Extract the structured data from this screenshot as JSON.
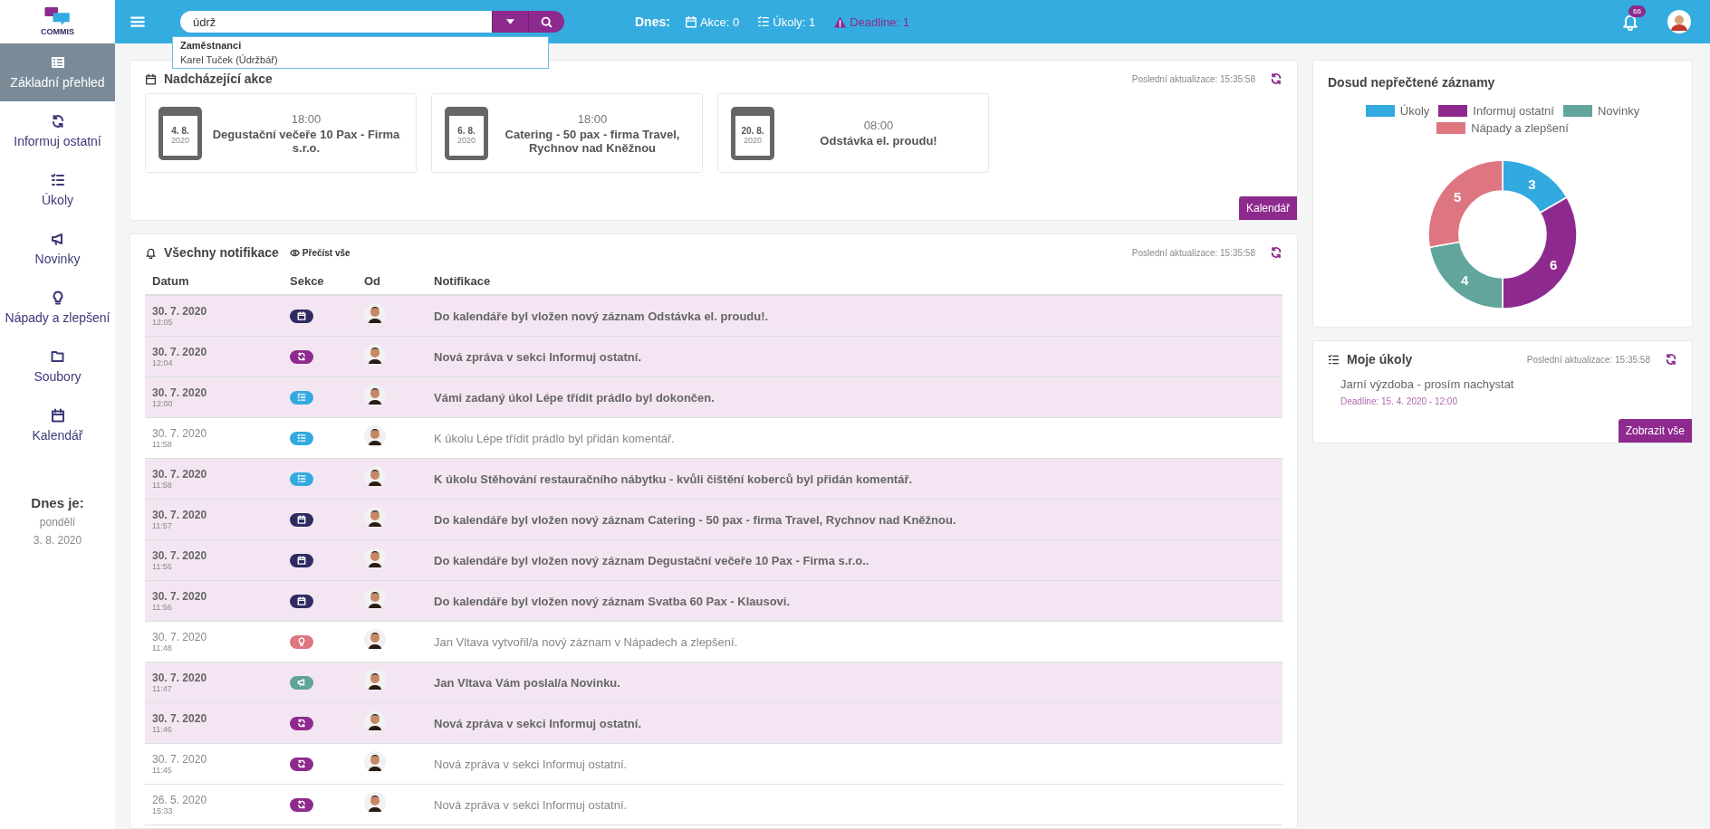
{
  "logo": {
    "text": "COMMIS"
  },
  "topbar": {
    "search": {
      "value": "údrž"
    },
    "today_label": "Dnes:",
    "stats": [
      {
        "kind": "calendar",
        "text": "Akce: 0"
      },
      {
        "kind": "checklist",
        "text": "Úkoly: 1"
      },
      {
        "kind": "warning",
        "text": "Deadline: 1"
      }
    ],
    "notification_count": "66"
  },
  "search_dropdown": {
    "heading": "Zaměstnanci",
    "items": [
      "Karel Tuček (Údržbář)"
    ]
  },
  "sidebar": {
    "items": [
      {
        "kind": "table",
        "label": "Základní přehled",
        "selected": true
      },
      {
        "kind": "refresh",
        "label": "Informuj ostatní",
        "selected": false
      },
      {
        "kind": "checklist",
        "label": "Úkoly",
        "selected": false
      },
      {
        "kind": "megaphone",
        "label": "Novinky",
        "selected": false
      },
      {
        "kind": "lightbulb",
        "label": "Nápady a zlepšení",
        "selected": false
      },
      {
        "kind": "folder",
        "label": "Soubory",
        "selected": false
      },
      {
        "kind": "calendar",
        "label": "Kalendář",
        "selected": false
      }
    ],
    "today_heading": "Dnes je:",
    "weekday": "pondělí",
    "date": "3. 8. 2020"
  },
  "upcoming": {
    "title": "Nadcházející akce",
    "updated": "Poslední aktualizace: 15:35:58",
    "button": "Kalendář",
    "events": [
      {
        "day": "4. 8.",
        "year": "2020",
        "time": "18:00",
        "title": "Degustační večeře 10 Pax - Firma s.r.o."
      },
      {
        "day": "6. 8.",
        "year": "2020",
        "time": "18:00",
        "title": "Catering - 50 pax - firma Travel, Rychnov nad Kněžnou"
      },
      {
        "day": "20. 8.",
        "year": "2020",
        "time": "08:00",
        "title": "Odstávka el. proudu!"
      }
    ]
  },
  "notifications": {
    "title": "Všechny notifikace",
    "read_all": "Přečíst vše",
    "updated": "Poslední aktualizace: 15:35:58",
    "columns": [
      "Datum",
      "Sekce",
      "Od",
      "Notifikace"
    ],
    "rows": [
      {
        "date": "30. 7. 2020",
        "time": "12:05",
        "kind": "calendar",
        "text": "Do kalendáře byl vložen nový záznam Odstávka el. proudu!.",
        "unread": true
      },
      {
        "date": "30. 7. 2020",
        "time": "12:04",
        "kind": "refresh",
        "text": "Nová zpráva v sekci Informuj ostatní.",
        "unread": true
      },
      {
        "date": "30. 7. 2020",
        "time": "12:00",
        "kind": "checklist",
        "text": "Vámi zadaný úkol Lépe třídit prádlo byl dokončen.",
        "unread": true
      },
      {
        "date": "30. 7. 2020",
        "time": "11:58",
        "kind": "checklist",
        "text": "K úkolu Lépe třídit prádlo byl přidán komentář.",
        "unread": false
      },
      {
        "date": "30. 7. 2020",
        "time": "11:58",
        "kind": "checklist",
        "text": "K úkolu Stěhování restauračního nábytku - kvůli čištění koberců byl přidán komentář.",
        "unread": true
      },
      {
        "date": "30. 7. 2020",
        "time": "11:57",
        "kind": "calendar",
        "text": "Do kalendáře byl vložen nový záznam Catering - 50 pax - firma Travel, Rychnov nad Kněžnou.",
        "unread": true
      },
      {
        "date": "30. 7. 2020",
        "time": "11:56",
        "kind": "calendar",
        "text": "Do kalendáře byl vložen nový záznam Degustační večeře 10 Pax - Firma s.r.o..",
        "unread": true
      },
      {
        "date": "30. 7. 2020",
        "time": "11:56",
        "kind": "calendar",
        "text": "Do kalendáře byl vložen nový záznam Svatba 60 Pax - Klausovi.",
        "unread": true
      },
      {
        "date": "30. 7. 2020",
        "time": "11:48",
        "kind": "lightbulb",
        "text": "Jan Vltava vytvořil/a nový záznam v Nápadech a zlepšení.",
        "unread": false
      },
      {
        "date": "30. 7. 2020",
        "time": "11:47",
        "kind": "megaphone",
        "text": "Jan Vltava Vám poslal/a Novinku.",
        "unread": true
      },
      {
        "date": "30. 7. 2020",
        "time": "11:46",
        "kind": "refresh",
        "text": "Nová zpráva v sekci Informuj ostatní.",
        "unread": true
      },
      {
        "date": "30. 7. 2020",
        "time": "11:45",
        "kind": "refresh",
        "text": "Nová zpráva v sekci Informuj ostatní.",
        "unread": false
      },
      {
        "date": "26. 5. 2020",
        "time": "15:33",
        "kind": "refresh",
        "text": "Nová zpráva v sekci Informuj ostatní.",
        "unread": false
      }
    ]
  },
  "unread_chart": {
    "title": "Dosud nepřečtené záznamy",
    "chart_data": {
      "type": "donut",
      "categories": [
        "Úkoly",
        "Informuj ostatní",
        "Novinky",
        "Nápady a zlepšení"
      ],
      "series": [
        {
          "colors": [
            "#33aadf",
            "#8e2a8e",
            "#62a59c",
            "#de7681"
          ],
          "values": [
            3,
            6,
            4,
            5
          ]
        }
      ],
      "data_labels": true
    }
  },
  "my_tasks": {
    "title": "Moje úkoly",
    "updated": "Poslední aktualizace: 15:35:58",
    "button": "Zobrazit vše",
    "items": [
      {
        "title": "Jarní výzdoba - prosím nachystat",
        "deadline": "Deadline: 15. 4. 2020 - 12:00"
      }
    ]
  }
}
